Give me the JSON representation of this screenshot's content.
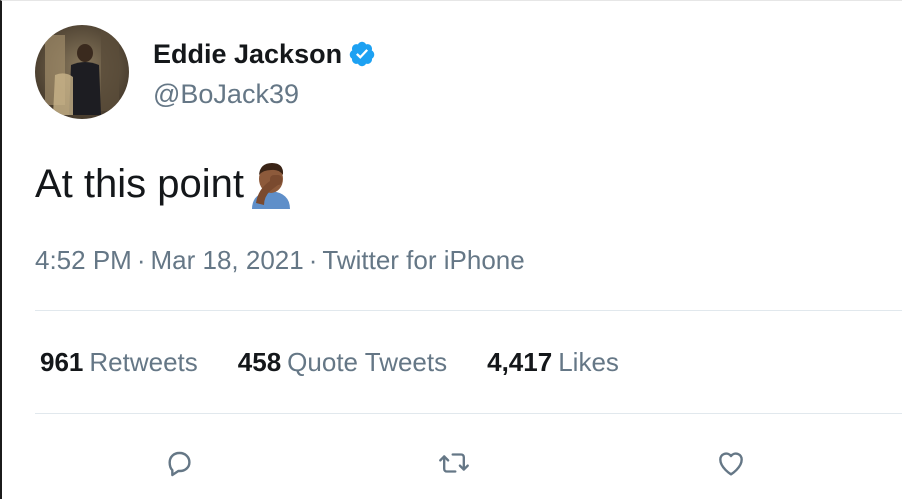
{
  "author": {
    "display_name": "Eddie Jackson",
    "handle": "@BoJack39",
    "verified": true,
    "avatar_icon": "profile-photo"
  },
  "tweet": {
    "text": "At this point",
    "emoji_icon": "man-facepalming-medium-dark-skin-tone-emoji"
  },
  "meta": {
    "time": "4:52 PM",
    "date": "Mar 18, 2021",
    "source": "Twitter for iPhone",
    "separator": "·"
  },
  "stats": {
    "retweets_count": "961",
    "retweets_label": "Retweets",
    "quotes_count": "458",
    "quotes_label": "Quote Tweets",
    "likes_count": "4,417",
    "likes_label": "Likes"
  },
  "actions": [
    {
      "name": "reply",
      "icon": "reply-bubble-icon"
    },
    {
      "name": "retweet",
      "icon": "retweet-arrows-icon"
    },
    {
      "name": "like",
      "icon": "heart-icon"
    }
  ],
  "colors": {
    "verified_blue": "#1da1f2",
    "secondary_text": "#657786",
    "primary_text": "#14171a",
    "divider": "#e1e8ed"
  }
}
